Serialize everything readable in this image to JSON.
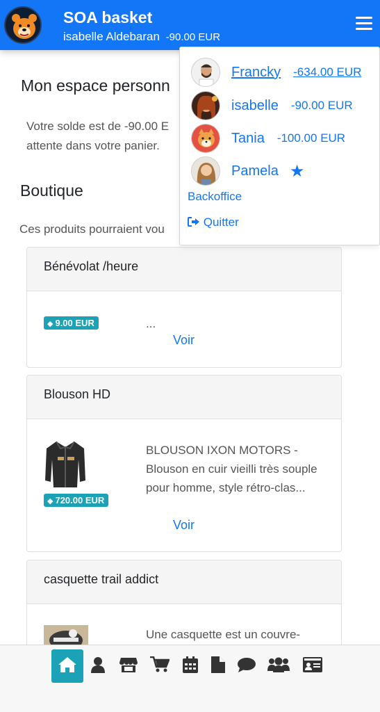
{
  "header": {
    "app_title": "SOA basket",
    "user_name": "isabelle Aldebaran",
    "user_balance": "-90.00 EUR"
  },
  "main": {
    "espace_title": "Mon espace personn",
    "solde_text": "Votre solde est de -90.00 EUR attente dans votre panier.",
    "solde_line1": "Votre solde est de -90.00 E",
    "solde_line2": "attente dans votre panier.",
    "boutique_title": "Boutique",
    "suggestion_text": "Ces produits pourraient vou"
  },
  "products": [
    {
      "name": "Bénévolat /heure",
      "price": "9.00 EUR",
      "description": "...",
      "view_label": "Voir"
    },
    {
      "name": "Blouson HD",
      "price": "720.00 EUR",
      "description": "BLOUSON IXON MOTORS - Blouson en cuir vieilli très souple pour homme, style rétro-clas...",
      "view_label": "Voir"
    },
    {
      "name": "casquette trail addict",
      "price": "",
      "description": "Une casquette est un couvre-",
      "view_label": ""
    }
  ],
  "dropdown": {
    "users": [
      {
        "name": "Francky",
        "balance": "-634.00 EUR"
      },
      {
        "name": "isabelle",
        "balance": "-90.00 EUR"
      },
      {
        "name": "Tania",
        "balance": "-100.00 EUR"
      },
      {
        "name": "Pamela",
        "balance": ""
      }
    ],
    "backoffice_label": "Backoffice",
    "quit_label": "Quitter"
  },
  "footer_nav": [
    {
      "icon": "home-icon"
    },
    {
      "icon": "user-icon"
    },
    {
      "icon": "store-icon"
    },
    {
      "icon": "cart-icon"
    },
    {
      "icon": "calendar-icon"
    },
    {
      "icon": "document-icon"
    },
    {
      "icon": "chat-icon"
    },
    {
      "icon": "users-icon"
    },
    {
      "icon": "id-card-icon"
    }
  ],
  "colors": {
    "primary": "#1276f7",
    "badge": "#1ba2b6"
  }
}
